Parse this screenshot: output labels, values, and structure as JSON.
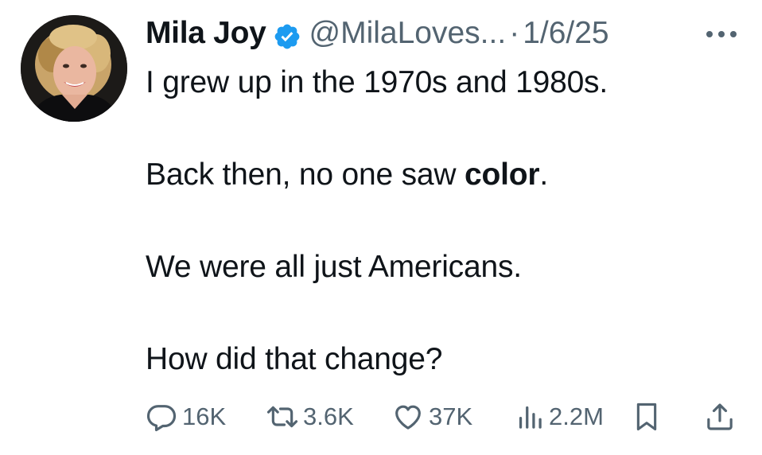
{
  "tweet": {
    "author": {
      "display_name": "Mila Joy",
      "handle": "@MilaLoves...",
      "verified_color": "#1d9bf0",
      "avatar_icon": "profile-photo"
    },
    "separator": "·",
    "date": "1/6/25",
    "more_icon": "ellipsis-icon",
    "text": {
      "line1": "I grew up in the 1970s and 1980s.",
      "line2_pre": "Back then, no one saw ",
      "line2_bold": "color",
      "line2_post": ".",
      "line3": "We were all just Americans.",
      "line4": "How did that change?"
    },
    "actions": {
      "replies": "16K",
      "reposts": "3.6K",
      "likes": "37K",
      "views": "2.2M",
      "icons": [
        "reply-icon",
        "repost-icon",
        "like-icon",
        "views-icon",
        "bookmark-icon",
        "share-icon"
      ]
    }
  }
}
